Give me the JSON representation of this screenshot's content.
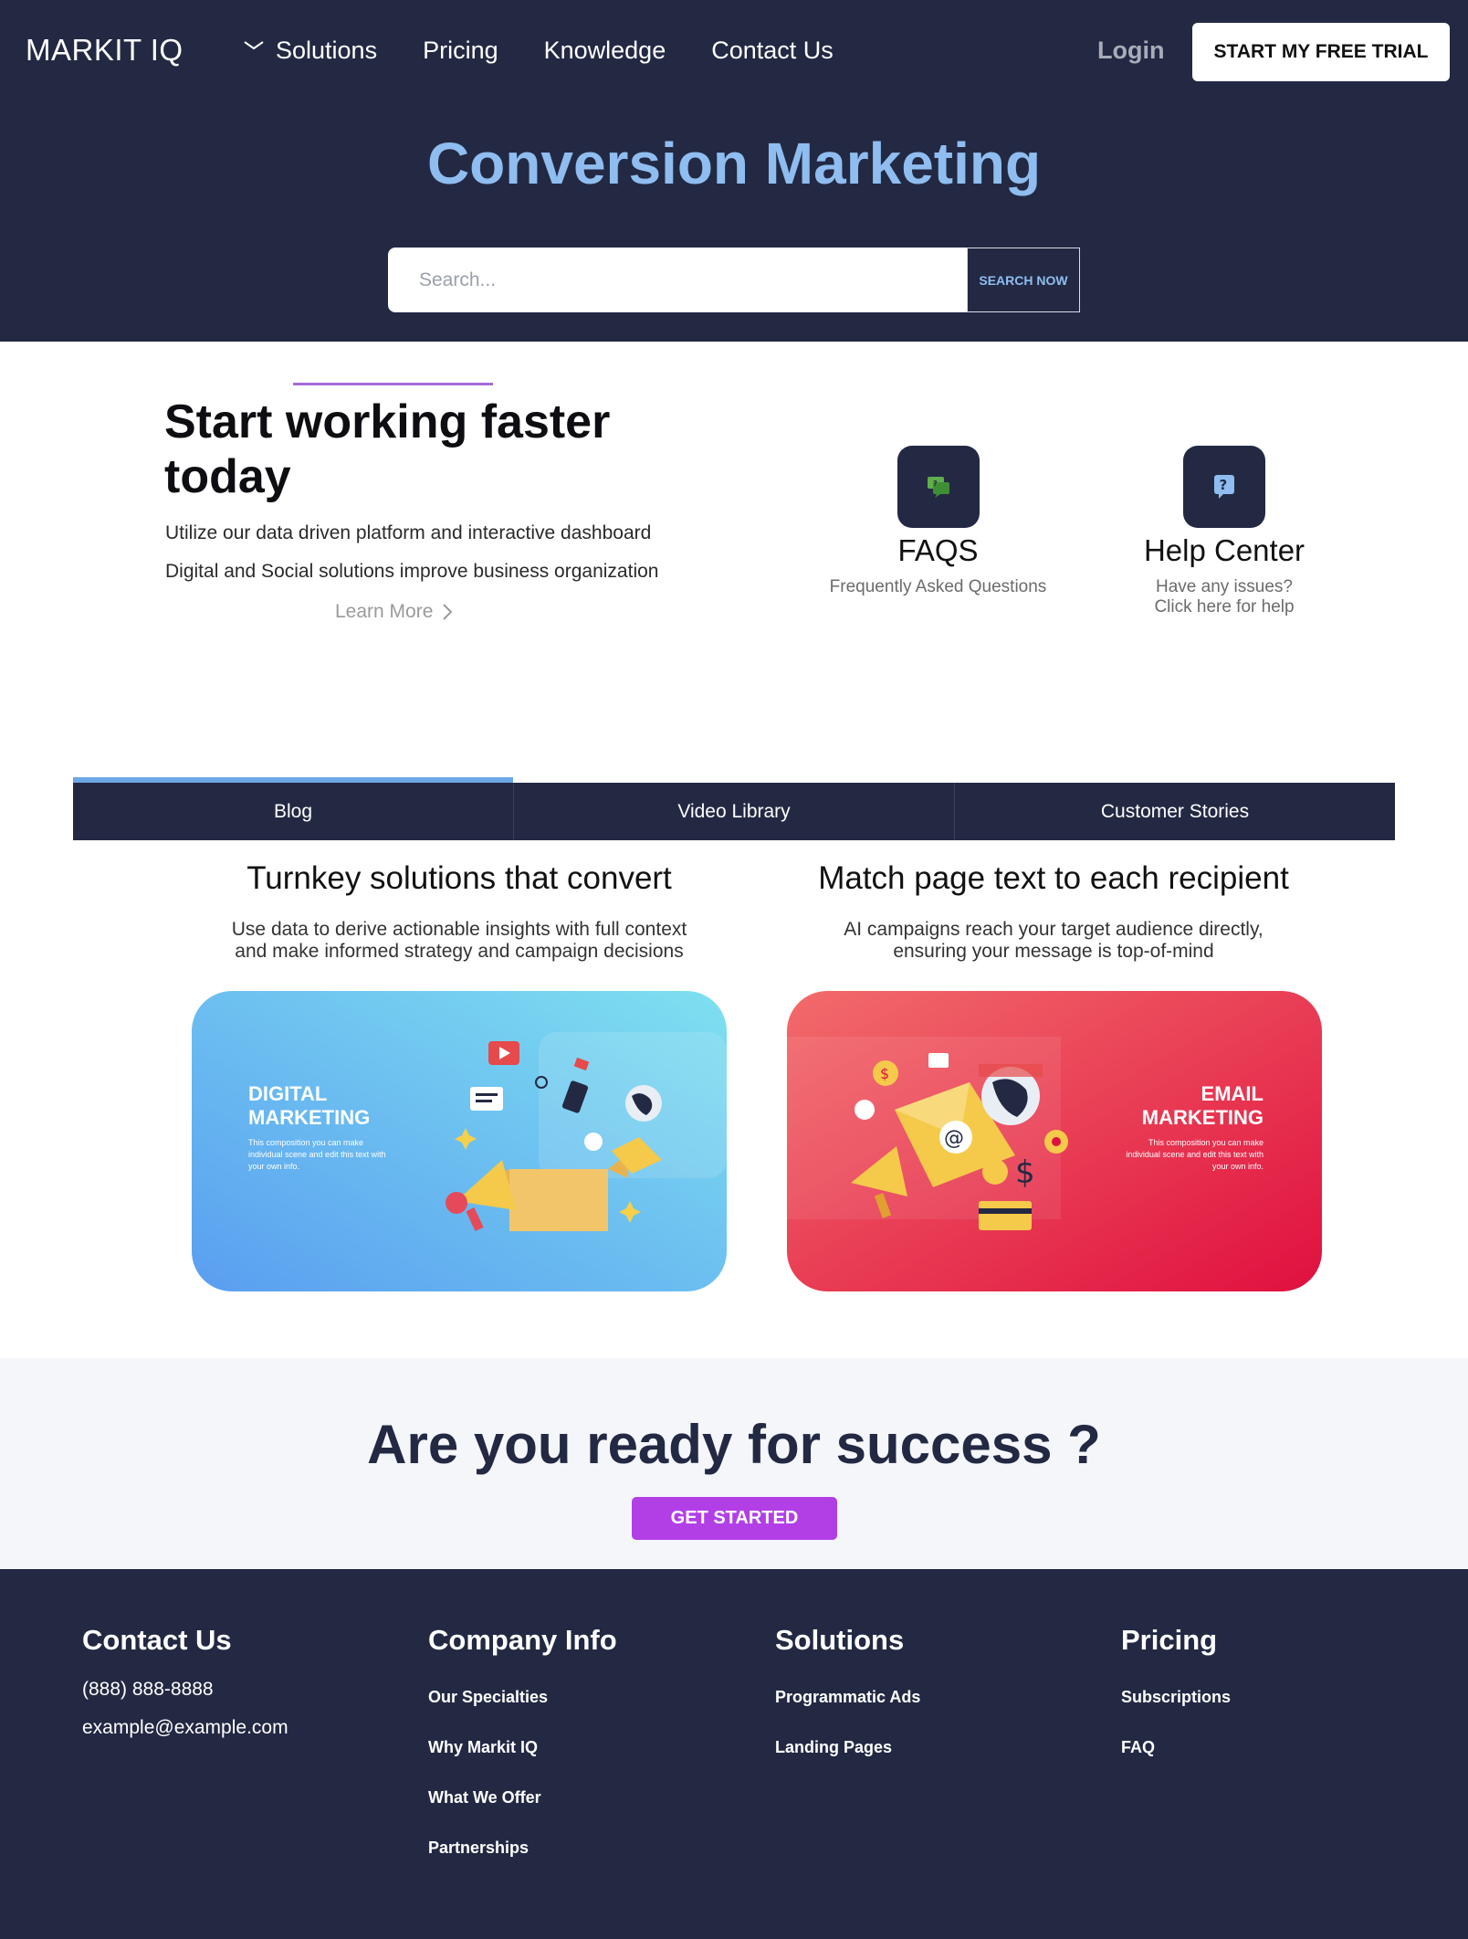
{
  "header": {
    "logo": "MARKIT IQ",
    "nav": [
      {
        "label": "Solutions"
      },
      {
        "label": "Pricing"
      },
      {
        "label": "Knowledge"
      },
      {
        "label": "Contact Us"
      }
    ],
    "login": "Login",
    "trial_button": "START MY FREE TRIAL"
  },
  "hero": {
    "title": "Conversion Marketing",
    "search_placeholder": "Search...",
    "search_button": "SEARCH NOW"
  },
  "feature": {
    "title": "Start working faster today",
    "lines": [
      "Utilize our data driven platform and interactive dashboard",
      "Digital and Social solutions improve business organization"
    ],
    "learn_more": "Learn More"
  },
  "help": {
    "faqs": {
      "title": "FAQS",
      "subtitle": "Frequently Asked Questions",
      "icon": "faq-chat-icon"
    },
    "center": {
      "title": "Help Center",
      "subtitle_1": "Have any issues?",
      "subtitle_2": "Click here for help",
      "icon": "question-icon"
    }
  },
  "tabs": {
    "items": [
      {
        "label": "Blog",
        "active": true
      },
      {
        "label": "Video Library",
        "active": false
      },
      {
        "label": "Customer Stories",
        "active": false
      }
    ]
  },
  "cards": [
    {
      "title": "Turnkey solutions that convert",
      "desc_1": "Use data to derive actionable insights with full context",
      "desc_2": "and make informed strategy and campaign decisions",
      "image_heading_1": "DIGITAL",
      "image_heading_2": "MARKETING",
      "image_caption": "This composition you can make individual scene and edit this text with your own info."
    },
    {
      "title": "Match page text to each recipient",
      "desc_1": "AI campaigns reach your target audience directly,",
      "desc_2": "ensuring your message is top-of-mind",
      "image_heading_1": "EMAIL",
      "image_heading_2": "MARKETING",
      "image_caption": "This composition you can make individual scene and edit this text with your own info."
    }
  ],
  "cta": {
    "title": "Are you ready for success ?",
    "button": "GET STARTED"
  },
  "footer": {
    "contact": {
      "heading": "Contact Us",
      "phone": "(888) 888-8888",
      "email": "example@example.com"
    },
    "company": {
      "heading": "Company Info",
      "links": [
        "Our Specialties",
        "Why Markit IQ",
        "What We Offer",
        "Partnerships"
      ]
    },
    "solutions": {
      "heading": "Solutions",
      "links": [
        "Programmatic Ads",
        "Landing Pages"
      ]
    },
    "pricing": {
      "heading": "Pricing",
      "links": [
        "Subscriptions",
        "FAQ"
      ]
    }
  },
  "colors": {
    "navy": "#232943",
    "hero_title": "#8fbdf0",
    "accent_purple": "#b23fe6",
    "tab_active": "#6ea7e6"
  }
}
